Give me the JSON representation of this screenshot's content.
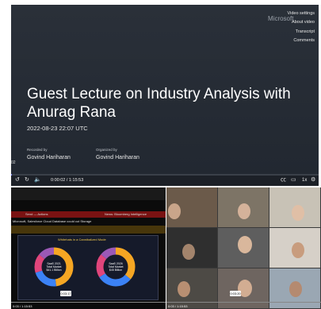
{
  "player": {
    "brand": "Microsoft",
    "menu": [
      "Video settings",
      "About video",
      "Transcript",
      "Comments"
    ],
    "title": "Guest Lecture on Industry Analysis with Anurag Rana",
    "date": "2022-08-23 22:07 UTC",
    "recorded_by_label": "Recorded by",
    "recorded_by": "Govind Hariharan",
    "organized_by_label": "Organized by",
    "organized_by": "Govind Hariharan",
    "corner_text": "02",
    "time": "0:00:02 / 1:15:53",
    "progress": 0.0004,
    "speed": "1x",
    "colors": {
      "accent": "#7b83ff",
      "background": "#262c35"
    }
  },
  "left_thumb": {
    "header_left": "Send — Actions",
    "header_right": "News: Bloomberg Intelligence",
    "subheader": "Microsoft, Salesforce Cloud Database could cut Storage",
    "panel_title": "Whitehats in a Cannibalized Mode",
    "donut_left": {
      "label1": "SaaS 2021",
      "label2": "Total Market",
      "label3": "$41.1 Billion",
      "segments": [
        0.48,
        0.22,
        0.16,
        0.14
      ]
    },
    "donut_right": {
      "label1": "SaaS 2026",
      "label2": "Total Market",
      "label3": "$45 Billion",
      "segments": [
        0.36,
        0.3,
        0.2,
        0.14
      ]
    },
    "timestamp": "0:03:17",
    "time": "0:03 / 1:15:53"
  },
  "right_thumb": {
    "timestamp": "0:03:20",
    "time": "0:03 / 1:15:53"
  }
}
